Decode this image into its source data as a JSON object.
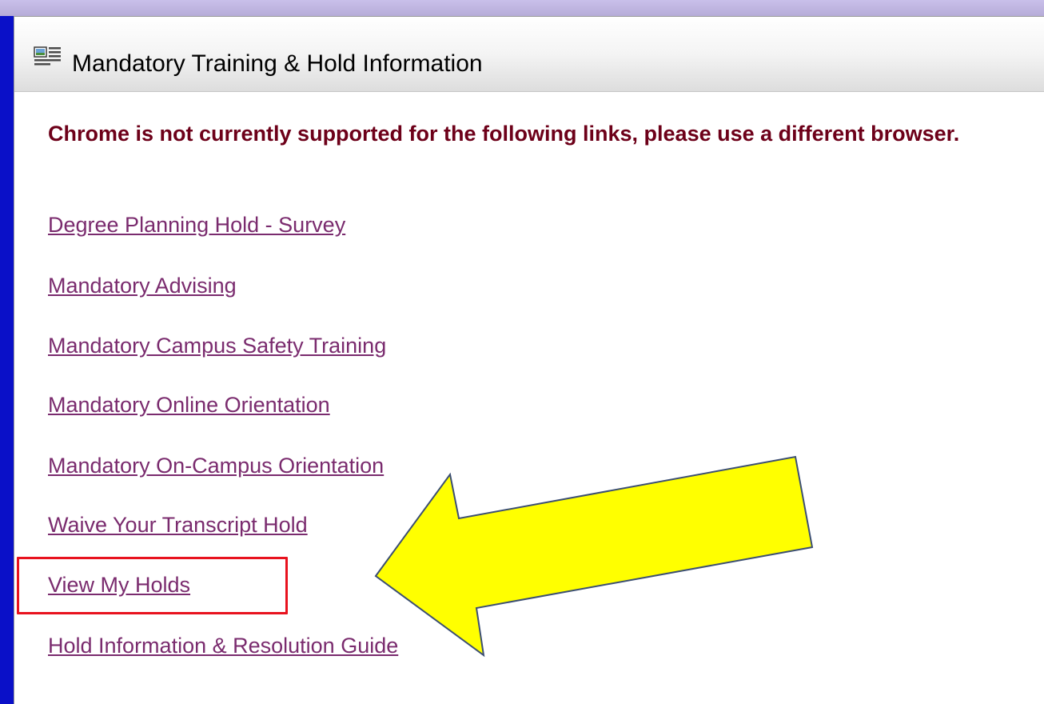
{
  "portlet": {
    "title": "Mandatory Training & Hold Information",
    "icon": "portlet-news-icon",
    "notice": "Chrome is not currently supported for the following links, please use a different browser."
  },
  "links": [
    "Degree Planning Hold - Survey",
    "Mandatory Advising",
    "Mandatory Campus Safety Training",
    "Mandatory Online Orientation",
    "Mandatory On-Campus Orientation",
    "Waive Your Transcript Hold",
    "View My Holds",
    "Hold Information & Resolution Guide"
  ],
  "annotations": {
    "highlighted_link": "View My Holds",
    "highlight_color": "#e8121e",
    "arrow_color": "#ffff00",
    "arrow_stroke": "#3b4e73"
  },
  "colors": {
    "frame": "#0a10c8",
    "notice_text": "#6d0019",
    "link_text": "#7a2b6e"
  }
}
